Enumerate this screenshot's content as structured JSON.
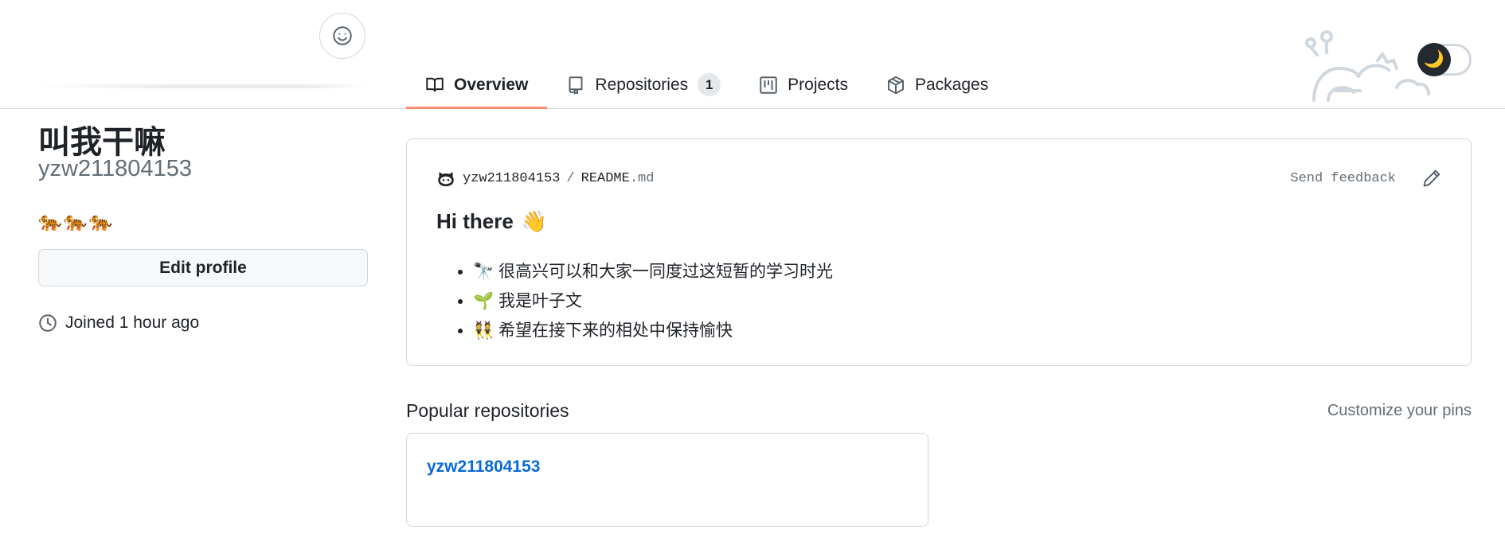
{
  "profile": {
    "display_name": "叫我干嘛",
    "login": "yzw211804153",
    "bio": "🐅🐅🐅",
    "edit_button": "Edit profile",
    "joined": "Joined 1 hour ago"
  },
  "tabs": [
    {
      "label": "Overview",
      "icon": "book-icon",
      "active": true
    },
    {
      "label": "Repositories",
      "icon": "repo-icon",
      "counter": "1"
    },
    {
      "label": "Projects",
      "icon": "project-icon"
    },
    {
      "label": "Packages",
      "icon": "package-icon"
    }
  ],
  "theme_toggle": {
    "icon": "moon-icon"
  },
  "readme": {
    "owner": "yzw211804153",
    "separator": "/",
    "file_base": "README",
    "file_ext": ".md",
    "feedback": "Send feedback",
    "title": "Hi there",
    "title_emoji": "👋",
    "items": [
      {
        "emoji": "🔭",
        "text": "很高兴可以和大家一同度过这短暂的学习时光"
      },
      {
        "emoji": "🌱",
        "text": "我是叶子文"
      },
      {
        "emoji": "👯",
        "text": "希望在接下来的相处中保持愉快"
      }
    ]
  },
  "popular": {
    "heading": "Popular repositories",
    "customize": "Customize your pins",
    "repos": [
      {
        "name": "yzw211804153"
      }
    ]
  },
  "colors": {
    "accent_underline": "#fd8c73",
    "link": "#0969da",
    "border": "#d0d7de",
    "muted": "#656d76"
  }
}
